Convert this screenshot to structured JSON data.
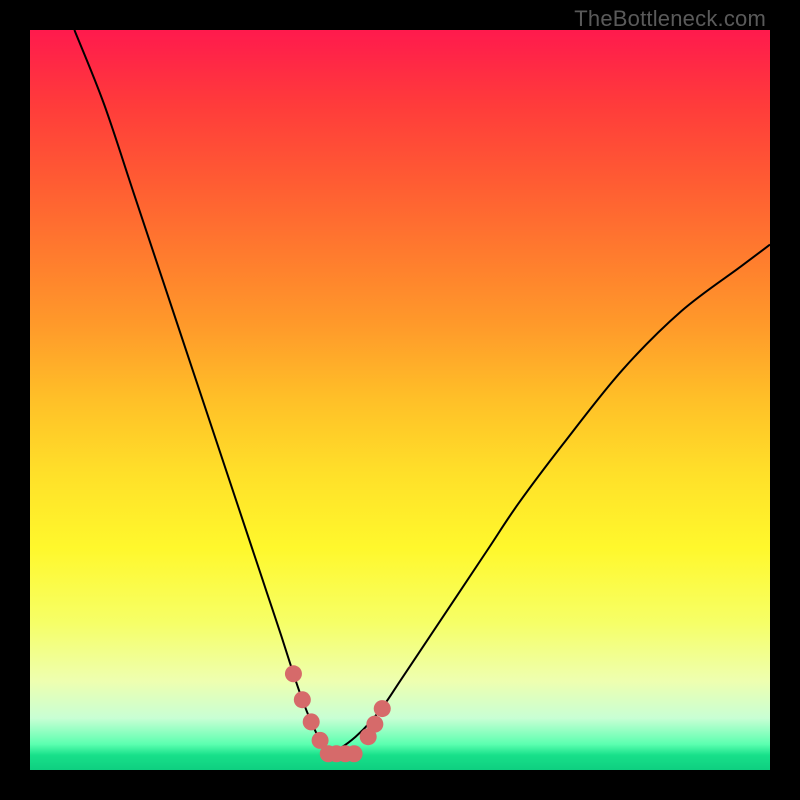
{
  "watermark": "TheBottleneck.com",
  "chart_data": {
    "type": "line",
    "title": "",
    "xlabel": "",
    "ylabel": "",
    "xlim": [
      0,
      100
    ],
    "ylim": [
      0,
      100
    ],
    "series": [
      {
        "name": "curve-left",
        "x": [
          6,
          10,
          14,
          18,
          22,
          26,
          30,
          32,
          34,
          35.6,
          36.8,
          38,
          39.2,
          40.3
        ],
        "y": [
          100,
          90,
          78,
          66,
          54,
          42,
          30,
          24,
          18,
          13,
          9.5,
          6.5,
          4,
          2.2
        ]
      },
      {
        "name": "curve-right",
        "x": [
          40.3,
          42,
          44,
          46,
          48,
          50,
          54,
          58,
          62,
          66,
          72,
          80,
          88,
          96,
          100
        ],
        "y": [
          2.2,
          3.0,
          4.5,
          6.5,
          9,
          12,
          18,
          24,
          30,
          36,
          44,
          54,
          62,
          68,
          71
        ]
      },
      {
        "name": "flat-bottom",
        "x": [
          35.6,
          36.8,
          38.0,
          39.2,
          40.3,
          41.4,
          42.6,
          43.8,
          45.7,
          46.6,
          47.6
        ],
        "y": [
          13,
          9.5,
          6.5,
          4.0,
          2.2,
          2.2,
          2.2,
          2.2,
          4.5,
          6.2,
          8.3
        ]
      }
    ],
    "markers": {
      "name": "salmon-dots",
      "color": "#d66a6a",
      "x": [
        35.6,
        36.8,
        38.0,
        39.2,
        40.3,
        41.4,
        42.6,
        43.8,
        45.7,
        46.6,
        47.6
      ],
      "y": [
        13,
        9.5,
        6.5,
        4.0,
        2.2,
        2.2,
        2.2,
        2.2,
        4.5,
        6.2,
        8.3
      ]
    },
    "gradient_stops": [
      {
        "pos": 0,
        "color": "#ff1a4d"
      },
      {
        "pos": 0.1,
        "color": "#ff3b3b"
      },
      {
        "pos": 0.2,
        "color": "#ff5a33"
      },
      {
        "pos": 0.3,
        "color": "#ff7a2e"
      },
      {
        "pos": 0.4,
        "color": "#ff9a2a"
      },
      {
        "pos": 0.5,
        "color": "#ffc028"
      },
      {
        "pos": 0.6,
        "color": "#ffe029"
      },
      {
        "pos": 0.7,
        "color": "#fff82c"
      },
      {
        "pos": 0.8,
        "color": "#f6ff66"
      },
      {
        "pos": 0.88,
        "color": "#eeffb0"
      },
      {
        "pos": 0.93,
        "color": "#c8ffd4"
      },
      {
        "pos": 0.965,
        "color": "#5cffb0"
      },
      {
        "pos": 0.98,
        "color": "#18e08a"
      },
      {
        "pos": 1.0,
        "color": "#0ecf80"
      }
    ]
  }
}
